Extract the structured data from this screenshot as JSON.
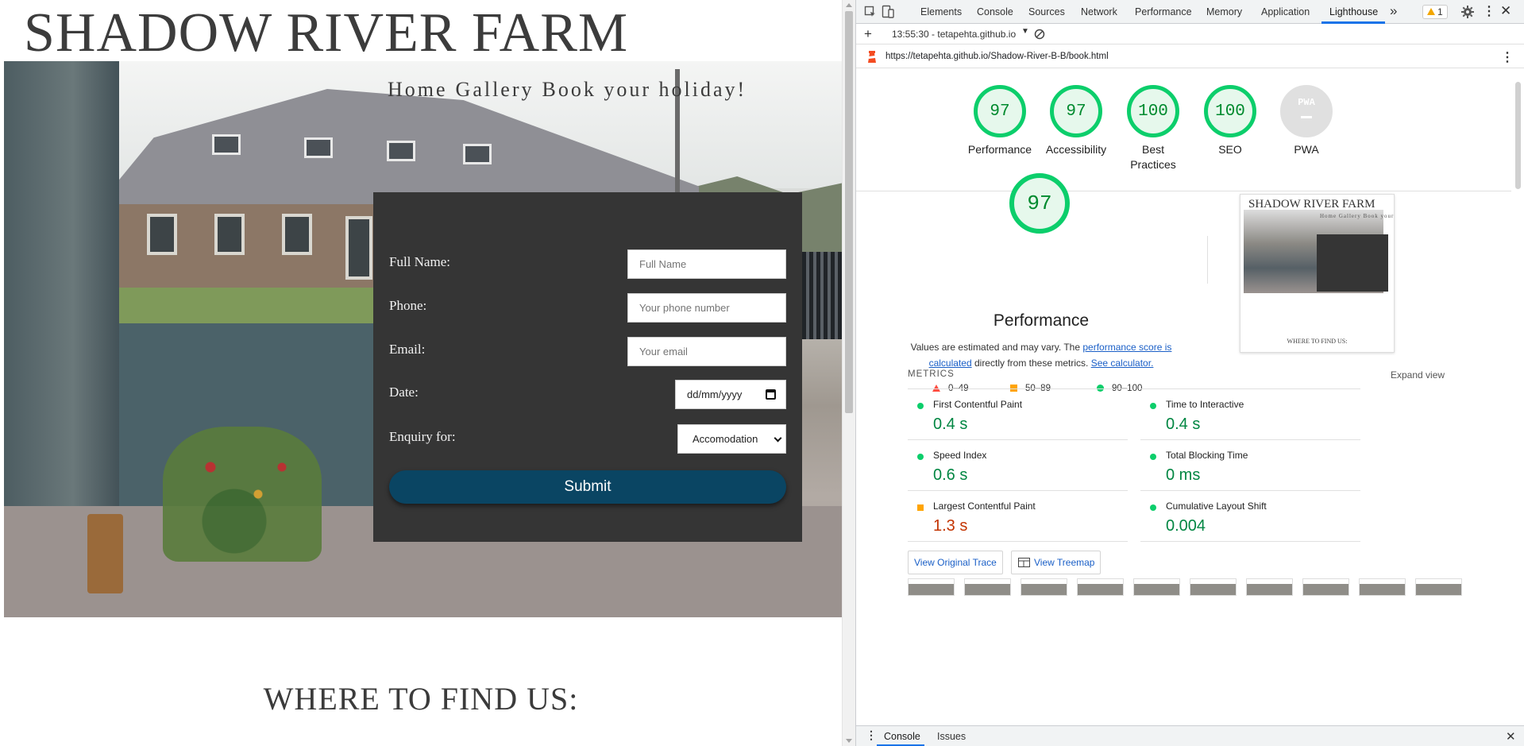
{
  "site": {
    "title": "SHADOW RIVER FARM",
    "nav": [
      "Home",
      "Gallery",
      "Book your holiday!"
    ],
    "form": {
      "fields": [
        {
          "label": "Full Name:",
          "placeholder": "Full Name"
        },
        {
          "label": "Phone:",
          "placeholder": "Your phone number"
        },
        {
          "label": "Email:",
          "placeholder": "Your email"
        }
      ],
      "date_label": "Date:",
      "date_value": "dd/mm/yyyy",
      "enquiry_label": "Enquiry for:",
      "enquiry_value": "Accomodation",
      "submit_label": "Submit"
    },
    "find_us": "WHERE TO FIND US:"
  },
  "devtools": {
    "tabs": [
      "Elements",
      "Console",
      "Sources",
      "Network",
      "Performance",
      "Memory",
      "Application",
      "Lighthouse"
    ],
    "active_tab": "Lighthouse",
    "warning_count": "1",
    "report_selector": "13:55:30 - tetapehta.github.io",
    "url": "https://tetapehta.github.io/Shadow-River-B-B/book.html",
    "scores": [
      {
        "label": "Performance",
        "value": "97"
      },
      {
        "label": "Accessibility",
        "value": "97"
      },
      {
        "label": "Best Practices",
        "value": "100"
      },
      {
        "label": "SEO",
        "value": "100"
      },
      {
        "label": "PWA",
        "value": "PWA"
      }
    ],
    "performance": {
      "score": "97",
      "title": "Performance",
      "desc_1": "Values are estimated and may vary. The ",
      "desc_link_1": "performance score is calculated",
      "desc_2": " directly from these metrics. ",
      "desc_link_2": "See calculator.",
      "legend": [
        "0–49",
        "50–89",
        "90–100"
      ]
    },
    "thumbnail": {
      "title": "SHADOW RIVER FARM",
      "nav": "Home Gallery Book your holiday!",
      "find_us": "WHERE TO FIND US:"
    },
    "metrics_heading": "METRICS",
    "expand_view": "Expand view",
    "metrics": [
      {
        "name": "First Contentful Paint",
        "value": "0.4 s",
        "status": "pass"
      },
      {
        "name": "Time to Interactive",
        "value": "0.4 s",
        "status": "pass"
      },
      {
        "name": "Speed Index",
        "value": "0.6 s",
        "status": "pass"
      },
      {
        "name": "Total Blocking Time",
        "value": "0 ms",
        "status": "pass"
      },
      {
        "name": "Largest Contentful Paint",
        "value": "1.3 s",
        "status": "average"
      },
      {
        "name": "Cumulative Layout Shift",
        "value": "0.004",
        "status": "pass"
      }
    ],
    "buttons": {
      "trace": "View Original Trace",
      "treemap": "View Treemap"
    },
    "drawer_tabs": [
      "Console",
      "Issues"
    ]
  },
  "colors": {
    "pass": "#0cce6b",
    "average": "#ffa400",
    "fail": "#ff4e42",
    "submit": "#0a4563",
    "form_bg": "#353535"
  }
}
